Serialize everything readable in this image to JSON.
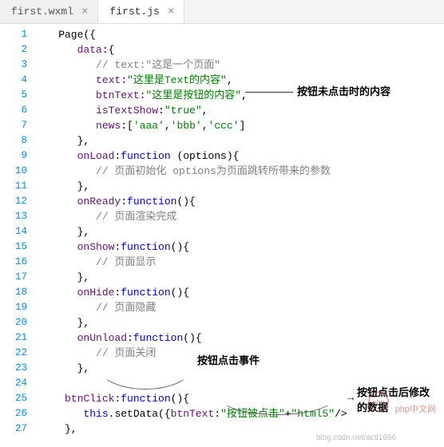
{
  "tabs": [
    {
      "label": "first.wxml",
      "active": false
    },
    {
      "label": "first.js",
      "active": true
    }
  ],
  "lines": [
    {
      "n": 1,
      "tokens": [
        [
          "plain",
          "    Page({"
        ]
      ]
    },
    {
      "n": 2,
      "tokens": [
        [
          "plain",
          "       "
        ],
        [
          "prop",
          "data"
        ],
        [
          "plain",
          ":{"
        ]
      ]
    },
    {
      "n": 3,
      "tokens": [
        [
          "plain",
          "          "
        ],
        [
          "comment",
          "// text:\"这是一个页面\""
        ]
      ]
    },
    {
      "n": 4,
      "tokens": [
        [
          "plain",
          "          "
        ],
        [
          "prop",
          "text"
        ],
        [
          "plain",
          ":"
        ],
        [
          "str",
          "\"这里是Text的内容\""
        ],
        [
          "plain",
          ","
        ]
      ]
    },
    {
      "n": 5,
      "tokens": [
        [
          "plain",
          "          "
        ],
        [
          "prop",
          "btnText"
        ],
        [
          "plain",
          ":"
        ],
        [
          "str",
          "\"这里是按钮的内容\""
        ],
        [
          "plain",
          ","
        ]
      ]
    },
    {
      "n": 6,
      "tokens": [
        [
          "plain",
          "          "
        ],
        [
          "prop",
          "isTextShow"
        ],
        [
          "plain",
          ":"
        ],
        [
          "str",
          "\"true\""
        ],
        [
          "plain",
          ","
        ]
      ]
    },
    {
      "n": 7,
      "tokens": [
        [
          "plain",
          "          "
        ],
        [
          "prop",
          "news"
        ],
        [
          "plain",
          ":["
        ],
        [
          "str",
          "'aaa'"
        ],
        [
          "plain",
          ","
        ],
        [
          "str",
          "'bbb'"
        ],
        [
          "plain",
          ","
        ],
        [
          "str",
          "'ccc'"
        ],
        [
          "plain",
          "]"
        ]
      ]
    },
    {
      "n": 8,
      "tokens": [
        [
          "plain",
          "       },"
        ]
      ]
    },
    {
      "n": 9,
      "tokens": [
        [
          "plain",
          "       "
        ],
        [
          "prop",
          "onLoad"
        ],
        [
          "plain",
          ":"
        ],
        [
          "kw",
          "function "
        ],
        [
          "plain",
          "(options){"
        ]
      ]
    },
    {
      "n": 10,
      "tokens": [
        [
          "plain",
          "          "
        ],
        [
          "comment",
          "// 页面初始化 options为页面跳转所带来的参数"
        ]
      ]
    },
    {
      "n": 11,
      "tokens": [
        [
          "plain",
          "       },"
        ]
      ]
    },
    {
      "n": 12,
      "tokens": [
        [
          "plain",
          "       "
        ],
        [
          "prop",
          "onReady"
        ],
        [
          "plain",
          ":"
        ],
        [
          "kw",
          "function"
        ],
        [
          "plain",
          "(){"
        ]
      ]
    },
    {
      "n": 13,
      "tokens": [
        [
          "plain",
          "          "
        ],
        [
          "comment",
          "// 页面渲染完成"
        ]
      ]
    },
    {
      "n": 14,
      "tokens": [
        [
          "plain",
          "       },"
        ]
      ]
    },
    {
      "n": 15,
      "tokens": [
        [
          "plain",
          "       "
        ],
        [
          "prop",
          "onShow"
        ],
        [
          "plain",
          ":"
        ],
        [
          "kw",
          "function"
        ],
        [
          "plain",
          "(){"
        ]
      ]
    },
    {
      "n": 16,
      "tokens": [
        [
          "plain",
          "          "
        ],
        [
          "comment",
          "// 页面显示"
        ]
      ]
    },
    {
      "n": 17,
      "tokens": [
        [
          "plain",
          "       },"
        ]
      ]
    },
    {
      "n": 18,
      "tokens": [
        [
          "plain",
          "       "
        ],
        [
          "prop",
          "onHide"
        ],
        [
          "plain",
          ":"
        ],
        [
          "kw",
          "function"
        ],
        [
          "plain",
          "(){"
        ]
      ]
    },
    {
      "n": 19,
      "tokens": [
        [
          "plain",
          "          "
        ],
        [
          "comment",
          "// 页面隐藏"
        ]
      ]
    },
    {
      "n": 20,
      "tokens": [
        [
          "plain",
          "       },"
        ]
      ]
    },
    {
      "n": 21,
      "tokens": [
        [
          "plain",
          "       "
        ],
        [
          "prop",
          "onUnload"
        ],
        [
          "plain",
          ":"
        ],
        [
          "kw",
          "function"
        ],
        [
          "plain",
          "(){"
        ]
      ]
    },
    {
      "n": 22,
      "tokens": [
        [
          "plain",
          "          "
        ],
        [
          "comment",
          "// 页面关闭"
        ]
      ]
    },
    {
      "n": 23,
      "tokens": [
        [
          "plain",
          "       },"
        ]
      ]
    },
    {
      "n": 24,
      "tokens": [
        [
          "plain",
          ""
        ]
      ]
    },
    {
      "n": 25,
      "tokens": [
        [
          "plain",
          "     "
        ],
        [
          "prop",
          "btnClick"
        ],
        [
          "plain",
          ":"
        ],
        [
          "kw",
          "function"
        ],
        [
          "plain",
          "(){"
        ]
      ]
    },
    {
      "n": 26,
      "tokens": [
        [
          "plain",
          "        "
        ],
        [
          "kw",
          "this"
        ],
        [
          "plain",
          ".setData({"
        ],
        [
          "prop",
          "btnText"
        ],
        [
          "plain",
          ":"
        ],
        [
          "str",
          "\"按钮被点击\""
        ],
        [
          "plain",
          "+"
        ],
        [
          "str",
          "\"html5\""
        ],
        [
          "plain",
          "/>"
        ]
      ]
    },
    {
      "n": 27,
      "tokens": [
        [
          "plain",
          "     },"
        ]
      ]
    }
  ],
  "annotations": {
    "a1": "按钮未点击时的内容",
    "a2": "按钮点击事件",
    "a3a": "按钮点击后修改",
    "a3b": "的数据"
  },
  "watermark": {
    "brand": "php中文网",
    "blog": "blog.csdn.net/actl1666"
  }
}
